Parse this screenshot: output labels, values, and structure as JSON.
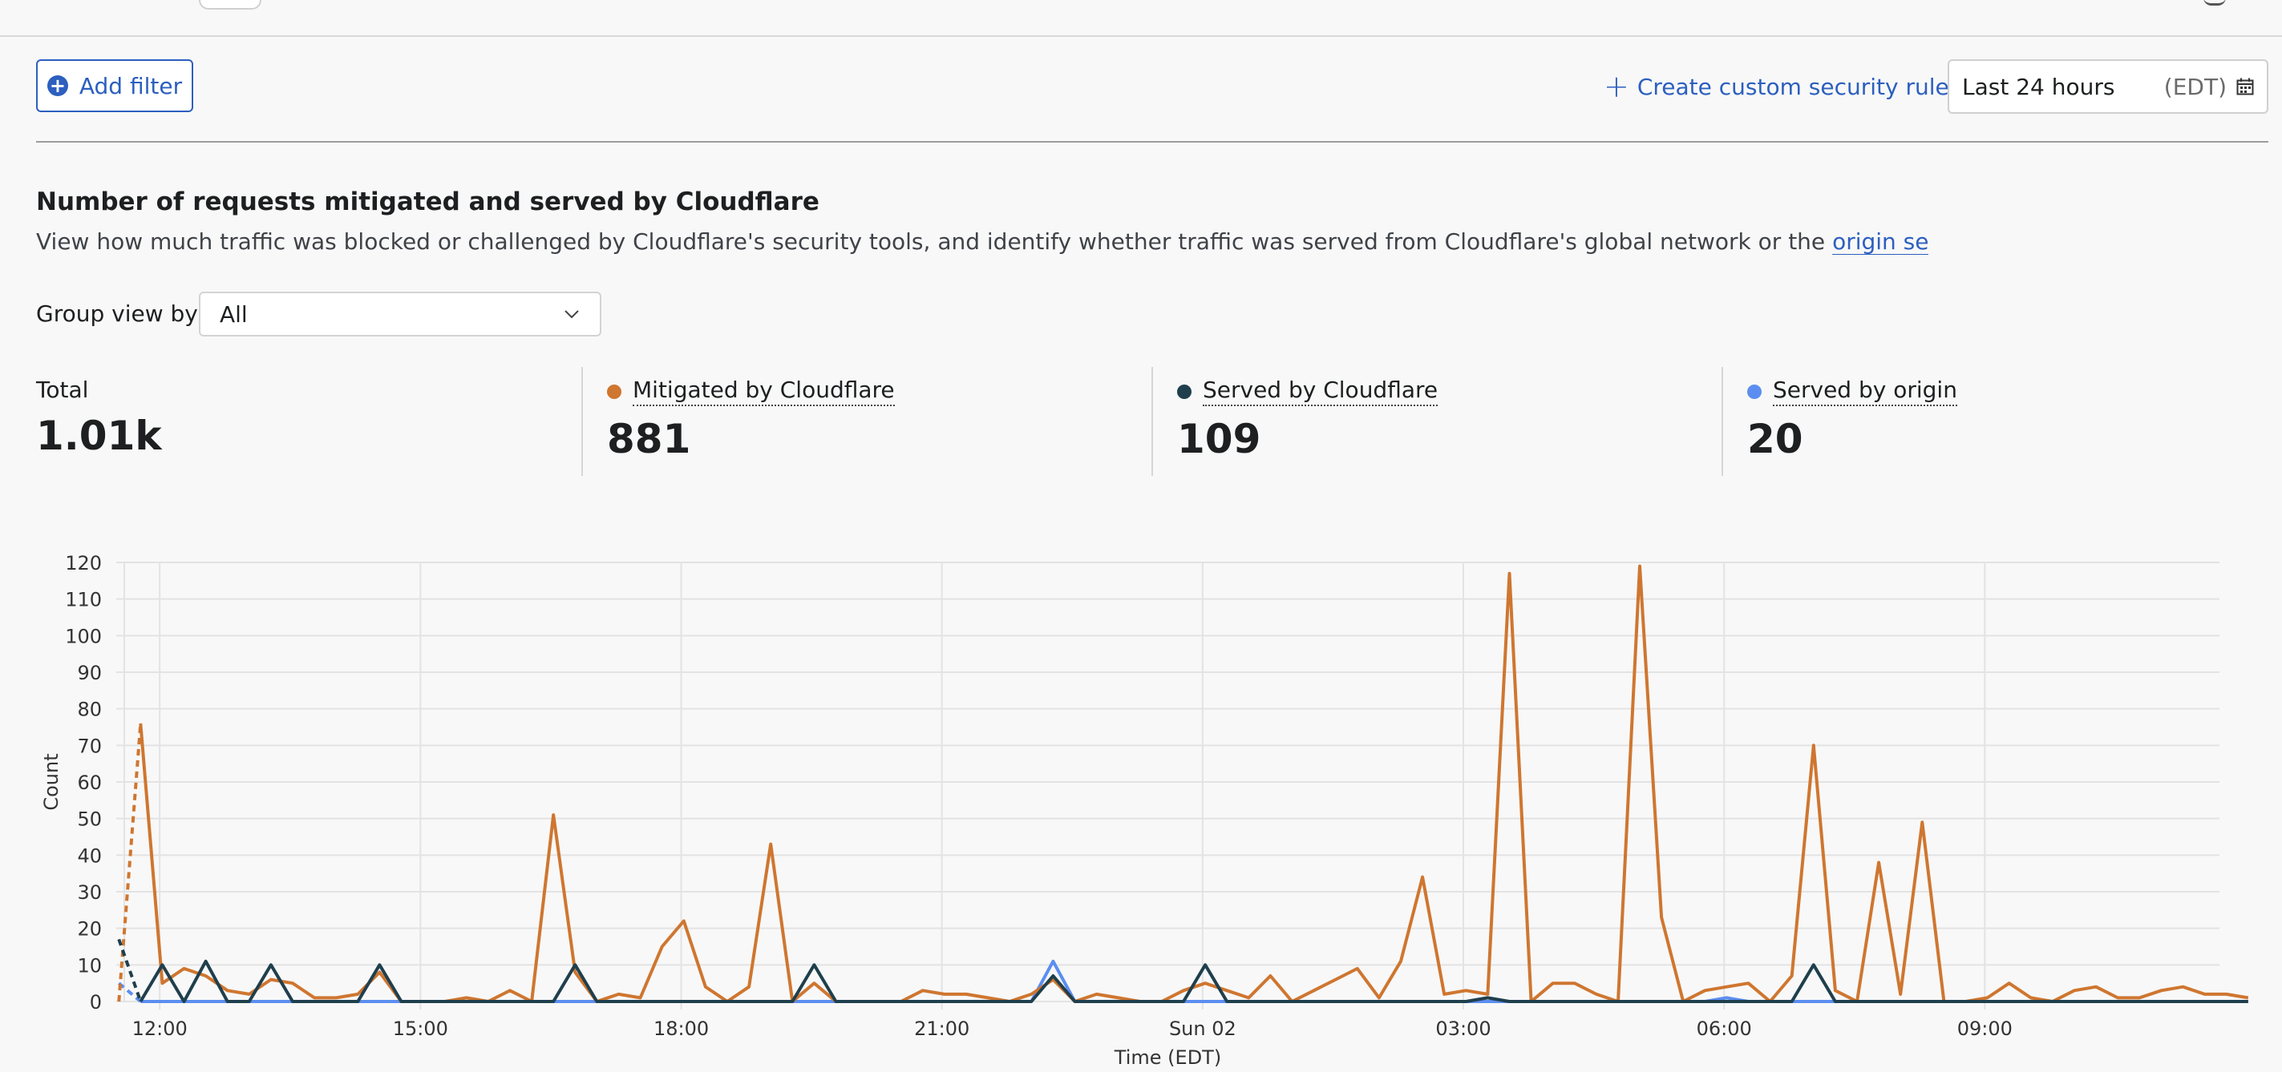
{
  "toolbar": {
    "add_filter_label": "Add filter",
    "create_rule_label": "Create custom security rule",
    "date_range_label": "Last 24 hours",
    "timezone_label": "(EDT)"
  },
  "section": {
    "title": "Number of requests mitigated and served by Cloudflare",
    "description_before_link": "View how much traffic was blocked or challenged by Cloudflare's security tools, and identify whether traffic was served from Cloudflare's global network or the ",
    "link_label": "origin server",
    "description_after_link": "."
  },
  "group_view": {
    "label": "Group view by",
    "selected": "All"
  },
  "stats": {
    "total": {
      "label": "Total",
      "value": "1.01k"
    },
    "mitigated": {
      "label": "Mitigated by Cloudflare",
      "value": "881",
      "color": "#cf7630"
    },
    "served_cf": {
      "label": "Served by Cloudflare",
      "value": "109",
      "color": "#1f3f4d"
    },
    "served_origin": {
      "label": "Served by origin",
      "value": "20",
      "color": "#5b8ef0"
    }
  },
  "icons": {
    "add_filter": "plus-circle-icon",
    "create_rule": "plus-icon",
    "date_picker": "calendar-icon",
    "origin_link": "external-link-icon",
    "select": "chevron-down-icon"
  },
  "colors": {
    "accent": "#2c5fbf",
    "mitigated": "#cf7630",
    "served_cf": "#1f3f4d",
    "served_origin": "#5b8ef0"
  },
  "chart_data": {
    "type": "line",
    "xlabel": "Time (EDT)",
    "ylabel": "Count",
    "ylim": [
      0,
      120
    ],
    "yticks": [
      0,
      10,
      20,
      30,
      40,
      50,
      60,
      70,
      80,
      90,
      100,
      110,
      120
    ],
    "x_start_hour": 11.5,
    "x_end_hour": 35.7,
    "x_step_minutes": 15,
    "xticks": [
      {
        "hour": 12,
        "label": "12:00"
      },
      {
        "hour": 15,
        "label": "15:00"
      },
      {
        "hour": 18,
        "label": "18:00"
      },
      {
        "hour": 21,
        "label": "21:00"
      },
      {
        "hour": 24,
        "label": "Sun 02"
      },
      {
        "hour": 27,
        "label": "03:00"
      },
      {
        "hour": 30,
        "label": "06:00"
      },
      {
        "hour": 33,
        "label": "09:00"
      }
    ],
    "grid": true,
    "legend": "none",
    "series": [
      {
        "name": "Mitigated by Cloudflare",
        "color": "#cf7630",
        "values": [
          0,
          76,
          5,
          9,
          7,
          3,
          2,
          6,
          5,
          1,
          1,
          2,
          8,
          0,
          0,
          0,
          1,
          0,
          3,
          0,
          51,
          8,
          0,
          2,
          1,
          15,
          22,
          4,
          0,
          4,
          43,
          0,
          5,
          0,
          0,
          0,
          0,
          3,
          2,
          2,
          1,
          0,
          2,
          6,
          0,
          2,
          1,
          0,
          0,
          3,
          5,
          3,
          1,
          7,
          0,
          3,
          6,
          9,
          1,
          11,
          34,
          2,
          3,
          2,
          117,
          0,
          5,
          5,
          2,
          0,
          119,
          23,
          0,
          3,
          4,
          5,
          0,
          7,
          70,
          3,
          0,
          38,
          2,
          49,
          0,
          0,
          1,
          5,
          1,
          0,
          3,
          4,
          1,
          1,
          3,
          4,
          2,
          2,
          1
        ]
      },
      {
        "name": "Served by Cloudflare",
        "color": "#1f3f4d",
        "values": [
          17,
          0,
          10,
          0,
          11,
          0,
          0,
          10,
          0,
          0,
          0,
          0,
          10,
          0,
          0,
          0,
          0,
          0,
          0,
          0,
          0,
          10,
          0,
          0,
          0,
          0,
          0,
          0,
          0,
          0,
          0,
          0,
          10,
          0,
          0,
          0,
          0,
          0,
          0,
          0,
          0,
          0,
          0,
          7,
          0,
          0,
          0,
          0,
          0,
          0,
          10,
          0,
          0,
          0,
          0,
          0,
          0,
          0,
          0,
          0,
          0,
          0,
          0,
          1,
          0,
          0,
          0,
          0,
          0,
          0,
          0,
          0,
          0,
          0,
          0,
          0,
          0,
          0,
          10,
          0,
          0,
          0,
          0,
          0,
          0,
          0,
          0,
          0,
          0,
          0,
          0,
          0,
          0,
          0,
          0,
          0,
          0,
          0,
          0
        ]
      },
      {
        "name": "Served by origin",
        "color": "#5b8ef0",
        "values": [
          5,
          0,
          0,
          0,
          0,
          0,
          0,
          0,
          0,
          0,
          0,
          0,
          0,
          0,
          0,
          0,
          0,
          0,
          0,
          0,
          0,
          0,
          0,
          0,
          0,
          0,
          0,
          0,
          0,
          0,
          0,
          0,
          0,
          0,
          0,
          0,
          0,
          0,
          0,
          0,
          0,
          0,
          0,
          11,
          0,
          0,
          0,
          0,
          0,
          0,
          0,
          0,
          0,
          0,
          0,
          0,
          0,
          0,
          0,
          0,
          0,
          0,
          0,
          0,
          0,
          0,
          0,
          0,
          0,
          0,
          0,
          0,
          0,
          0,
          1,
          0,
          0,
          0,
          0,
          0,
          0,
          0,
          0,
          0,
          0,
          0,
          0,
          0,
          0,
          0,
          0,
          0,
          0,
          0,
          0,
          0,
          0,
          0,
          0
        ]
      }
    ]
  }
}
